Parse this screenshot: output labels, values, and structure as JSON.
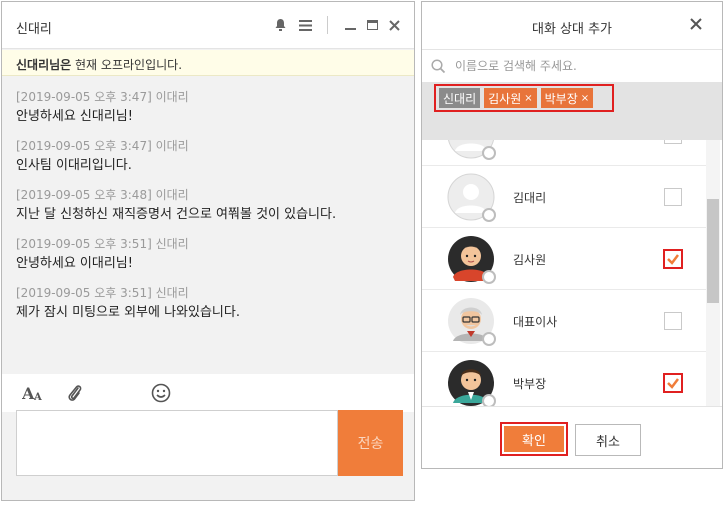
{
  "chat": {
    "title": "신대리",
    "notice_name": "신대리님은",
    "notice_text": " 현재 오프라인입니다.",
    "messages": [
      {
        "meta": "[2019-09-05 오후 3:47] 이대리",
        "text": "안녕하세요 신대리님!"
      },
      {
        "meta": "[2019-09-05 오후 3:47] 이대리",
        "text": "인사팀 이대리입니다."
      },
      {
        "meta": "[2019-09-05 오후 3:48] 이대리",
        "text": "지난 달 신청하신 재직증명서 건으로 여쭤볼 것이 있습니다."
      },
      {
        "meta": "[2019-09-05 오후 3:51] 신대리",
        "text": "안녕하세요 이대리님!"
      },
      {
        "meta": "[2019-09-05 오후 3:51] 신대리",
        "text": "제가 잠시 미팅으로 외부에 나와있습니다."
      }
    ],
    "send_label": "전송",
    "input_value": ""
  },
  "dialog": {
    "title": "대화 상대 추가",
    "search_placeholder": "이름으로 검색해 주세요.",
    "tags": [
      {
        "label": "신대리",
        "style": "gray",
        "removable": false
      },
      {
        "label": "김사원",
        "style": "orange",
        "removable": true
      },
      {
        "label": "박부장",
        "style": "orange",
        "removable": true
      }
    ],
    "tag_remove_glyph": "×",
    "rows": [
      {
        "name": "",
        "avatar": "default",
        "checked": false
      },
      {
        "name": "김대리",
        "avatar": "default",
        "checked": false
      },
      {
        "name": "김사원",
        "avatar": "red-shirt-man",
        "checked": true
      },
      {
        "name": "대표이사",
        "avatar": "gray-hair-man",
        "checked": false
      },
      {
        "name": "박부장",
        "avatar": "teal-suit-man",
        "checked": true
      }
    ],
    "ok_label": "확인",
    "cancel_label": "취소"
  },
  "icons": {
    "bell": "bell-icon",
    "menu": "menu-icon",
    "minimize": "minimize-icon",
    "maximize": "maximize-icon",
    "close": "close-icon",
    "font": "font-size-icon",
    "attach": "paperclip-icon",
    "emoji": "smiley-icon",
    "search": "search-icon",
    "check": "checkmark-icon"
  },
  "colors": {
    "accent": "#f07d3a",
    "highlight": "#e02020",
    "notice_bg": "#fffde8",
    "tag_gray": "#8b8b8b",
    "tag_orange": "#e8743a"
  }
}
